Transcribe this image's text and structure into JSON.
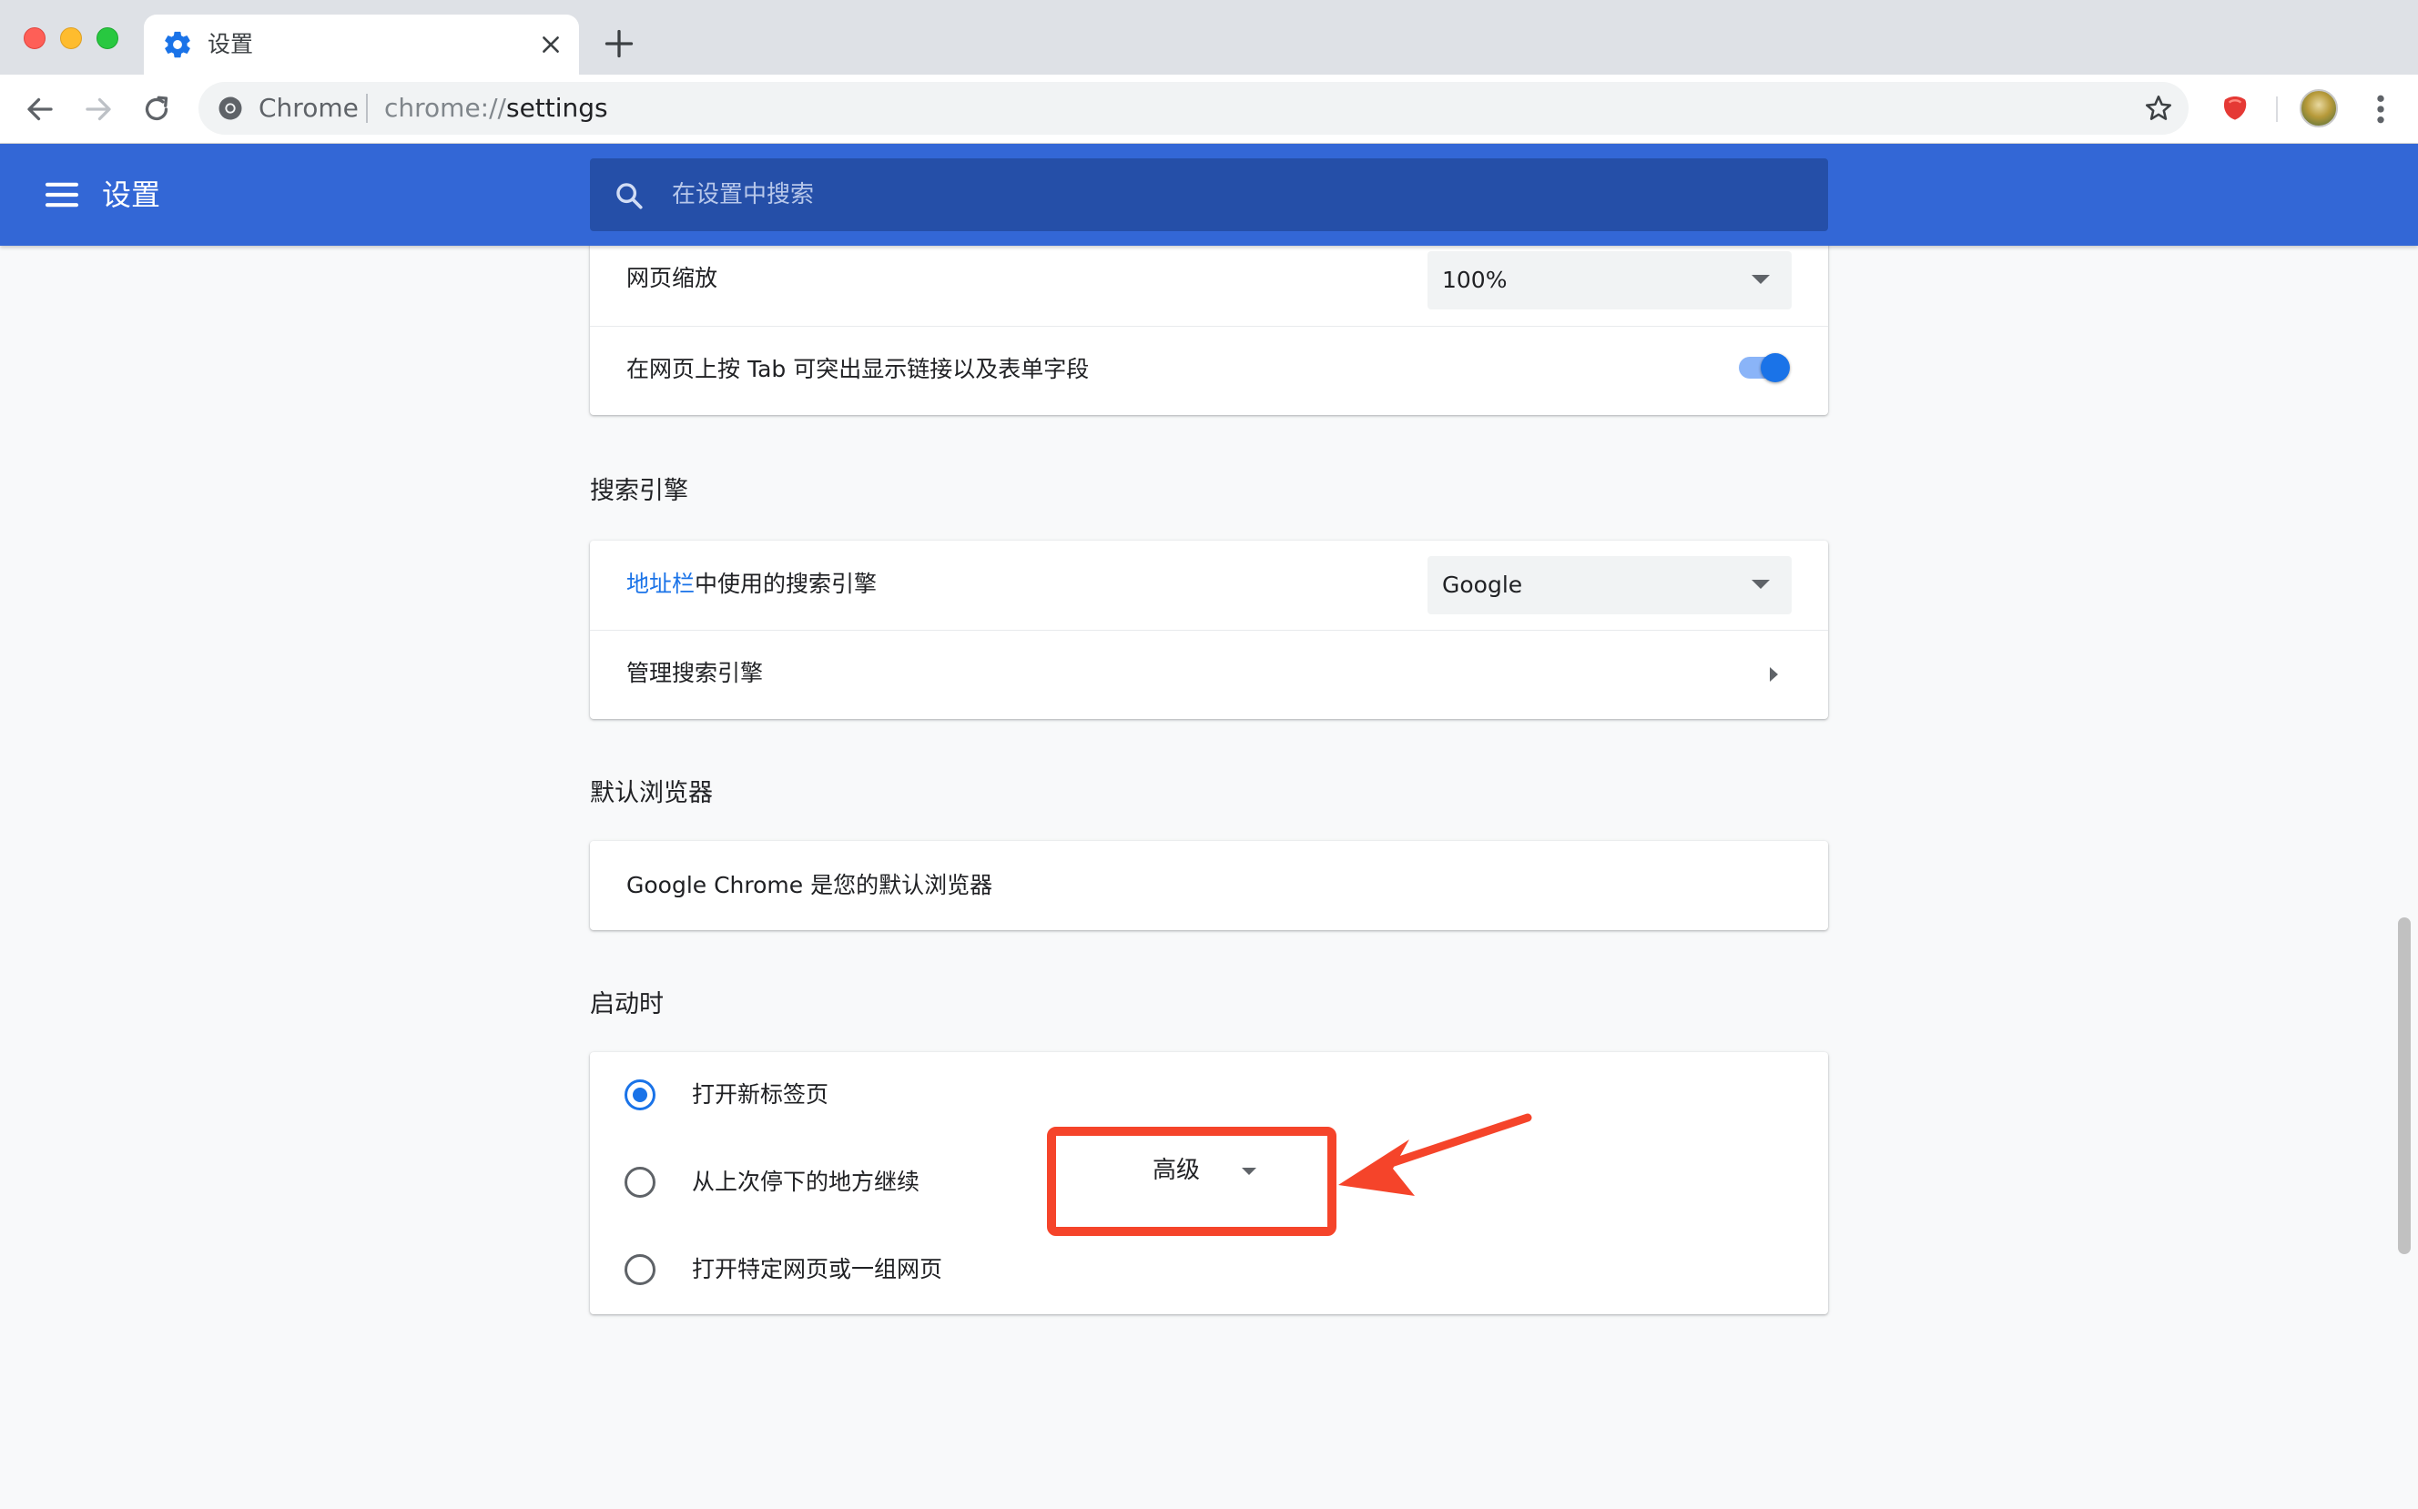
{
  "browser": {
    "tab_title": "设置",
    "omnibox": {
      "origin_label": "Chrome",
      "url_scheme": "chrome://",
      "url_path": "settings"
    }
  },
  "header": {
    "title": "设置",
    "search_placeholder": "在设置中搜索"
  },
  "appearance": {
    "zoom_label": "网页缩放",
    "zoom_value": "100%",
    "tab_highlight_label": "在网页上按 Tab 可突出显示链接以及表单字段",
    "tab_highlight_on": true
  },
  "search_engine": {
    "section_title": "搜索引擎",
    "engine_label_link": "地址栏",
    "engine_label_rest": "中使用的搜索引擎",
    "engine_value": "Google",
    "manage_label": "管理搜索引擎"
  },
  "default_browser": {
    "section_title": "默认浏览器",
    "status_text": "Google Chrome 是您的默认浏览器"
  },
  "on_startup": {
    "section_title": "启动时",
    "options": [
      {
        "label": "打开新标签页",
        "checked": true
      },
      {
        "label": "从上次停下的地方继续",
        "checked": false
      },
      {
        "label": "打开特定网页或一组网页",
        "checked": false
      }
    ]
  },
  "advanced": {
    "label": "高级"
  },
  "colors": {
    "header_blue": "#3367d6",
    "accent_blue": "#1a73e8",
    "annotation_red": "#f5442a"
  }
}
